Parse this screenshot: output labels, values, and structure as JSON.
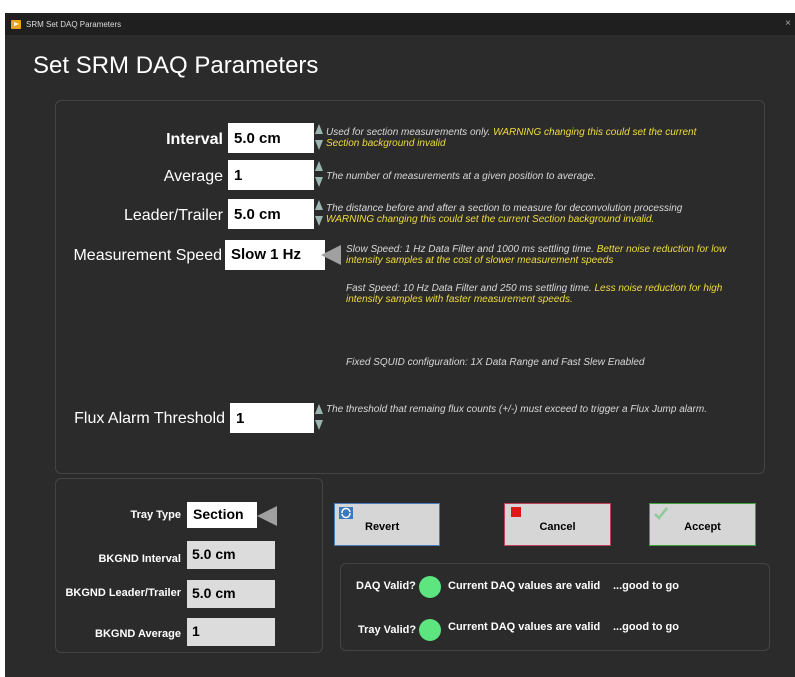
{
  "window": {
    "title": "SRM Set DAQ Parameters",
    "close_glyph": "×"
  },
  "heading": "Set SRM DAQ Parameters",
  "params": {
    "interval": {
      "label": "Interval",
      "value": "5.0 cm",
      "desc": "Used for section measurements only.",
      "warn": "WARNING changing this could set the current Section background invalid"
    },
    "average": {
      "label": "Average",
      "value": "1",
      "desc": "The number of measurements at a given position to average."
    },
    "leader_trailer": {
      "label": "Leader/Trailer",
      "value": "5.0 cm",
      "desc": "The distance before and after a section to measure for deconvolution processing",
      "warn": "WARNING changing this could set the current Section background invalid."
    },
    "speed": {
      "label": "Measurement Speed",
      "value": "Slow 1 Hz",
      "slow_desc": "Slow Speed:  1 Hz Data Filter and 1000 ms settling time.",
      "slow_note": "Better noise reduction for low intensity samples at the cost of slower measurement speeds",
      "fast_desc": "Fast Speed: 10 Hz Data Filter and 250 ms settling time.",
      "fast_note": "Less noise reduction for high intensity samples with faster measurement speeds."
    },
    "squid_note": "Fixed SQUID configuration:  1X Data Range and Fast Slew Enabled",
    "flux": {
      "label": "Flux Alarm Threshold",
      "value": "1",
      "desc": "The threshold that remaing flux counts (+/-) must exceed to trigger a Flux Jump alarm."
    }
  },
  "tray": {
    "type_label": "Tray Type",
    "type_value": "Section",
    "bkgnd_interval_label": "BKGND Interval",
    "bkgnd_interval_value": "5.0 cm",
    "bkgnd_leader_label": "BKGND Leader/Trailer",
    "bkgnd_leader_value": "5.0 cm",
    "bkgnd_average_label": "BKGND Average",
    "bkgnd_average_value": "1"
  },
  "buttons": {
    "revert": "Revert",
    "cancel": "Cancel",
    "accept": "Accept"
  },
  "status": {
    "daq_label": "DAQ Valid?",
    "daq_message": "Current DAQ values are valid",
    "daq_note": "...good to go",
    "tray_label": "Tray Valid?",
    "tray_message": "Current DAQ values are valid",
    "tray_note": "...good to go",
    "led_color": "#5de57f"
  },
  "colors": {
    "background": "#2b2b2b",
    "warning": "#f0dc3c",
    "cancel_border": "#c0405a",
    "accept_border": "#40a040",
    "revert_border": "#4a7ab8"
  },
  "icons": {
    "app": "labview-run-icon",
    "revert": "refresh-icon",
    "cancel": "stop-square-icon",
    "accept": "checkmark-icon"
  }
}
